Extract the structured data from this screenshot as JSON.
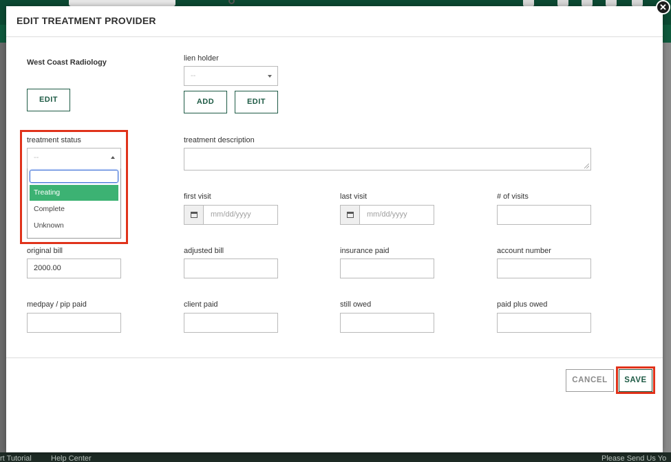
{
  "modal": {
    "title": "EDIT TREATMENT PROVIDER",
    "close_icon": "close-icon"
  },
  "provider": {
    "name": "West Coast Radiology",
    "edit_label": "EDIT"
  },
  "lien_holder": {
    "label": "lien holder",
    "value": "--",
    "add_label": "ADD",
    "edit_label": "EDIT"
  },
  "treatment_status": {
    "label": "treatment status",
    "value": "--",
    "options": [
      "Treating",
      "Complete",
      "Unknown"
    ],
    "highlighted": "Treating"
  },
  "treatment_description": {
    "label": "treatment description",
    "value": ""
  },
  "first_visit": {
    "label": "first visit",
    "placeholder": "mm/dd/yyyy"
  },
  "last_visit": {
    "label": "last visit",
    "placeholder": "mm/dd/yyyy"
  },
  "num_visits": {
    "label": "# of visits",
    "value": ""
  },
  "original_bill": {
    "label": "original bill",
    "value": "2000.00"
  },
  "adjusted_bill": {
    "label": "adjusted bill",
    "value": ""
  },
  "insurance_paid": {
    "label": "insurance paid",
    "value": ""
  },
  "account_number": {
    "label": "account number",
    "value": ""
  },
  "medpay_pip_paid": {
    "label": "medpay / pip paid",
    "value": ""
  },
  "client_paid": {
    "label": "client paid",
    "value": ""
  },
  "still_owed": {
    "label": "still owed",
    "value": ""
  },
  "paid_plus_owed": {
    "label": "paid plus owed",
    "value": ""
  },
  "actions": {
    "cancel_label": "CANCEL",
    "save_label": "SAVE"
  },
  "background_footer": {
    "left_text": "rt Tutorial",
    "help_text": "Help Center",
    "right_text": "Please Send Us Yo"
  },
  "colors": {
    "accent": "#1d5a44",
    "highlight": "#3cb273",
    "annotation": "#e0321a"
  }
}
